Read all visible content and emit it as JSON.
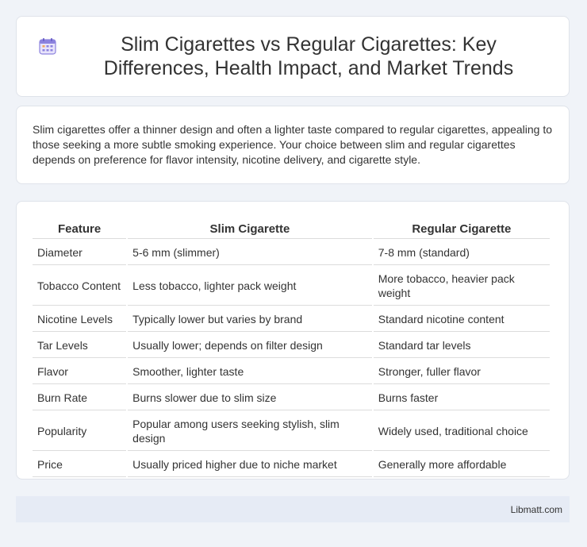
{
  "header": {
    "icon": "calendar-icon",
    "title": "Slim Cigarettes vs Regular Cigarettes: Key Differences, Health Impact, and Market Trends"
  },
  "intro": {
    "text": "Slim cigarettes offer a thinner design and often a lighter taste compared to regular cigarettes, appealing to those seeking a more subtle smoking experience. Your choice between slim and regular cigarettes depends on preference for flavor intensity, nicotine delivery, and cigarette style."
  },
  "table": {
    "headers": [
      "Feature",
      "Slim Cigarette",
      "Regular Cigarette"
    ],
    "rows": [
      [
        "Diameter",
        "5-6 mm (slimmer)",
        "7-8 mm (standard)"
      ],
      [
        "Tobacco Content",
        "Less tobacco, lighter pack weight",
        "More tobacco, heavier pack weight"
      ],
      [
        "Nicotine Levels",
        "Typically lower but varies by brand",
        "Standard nicotine content"
      ],
      [
        "Tar Levels",
        "Usually lower; depends on filter design",
        "Standard tar levels"
      ],
      [
        "Flavor",
        "Smoother, lighter taste",
        "Stronger, fuller flavor"
      ],
      [
        "Burn Rate",
        "Burns slower due to slim size",
        "Burns faster"
      ],
      [
        "Popularity",
        "Popular among users seeking stylish, slim design",
        "Widely used, traditional choice"
      ],
      [
        "Price",
        "Usually priced higher due to niche market",
        "Generally more affordable"
      ]
    ]
  },
  "footer": {
    "brand": "Libmatt.com"
  },
  "colors": {
    "background": "#f0f3f8",
    "card": "#ffffff",
    "footer": "#e6ebf5",
    "icon_accent": "#7b6fd6"
  }
}
